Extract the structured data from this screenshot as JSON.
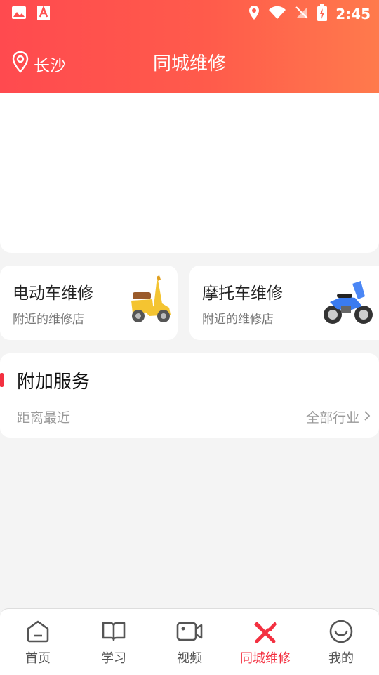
{
  "status_bar": {
    "time": "2:45"
  },
  "header": {
    "location": "长沙",
    "title": "同城维修"
  },
  "categories": [
    {
      "title": "电动车维修",
      "subtitle": "附近的维修店",
      "icon": "scooter-icon"
    },
    {
      "title": "摩托车维修",
      "subtitle": "附近的维修店",
      "icon": "motorcycle-icon"
    }
  ],
  "services": {
    "title": "附加服务",
    "sort_label": "距离最近",
    "industry_label": "全部行业"
  },
  "tabs": [
    {
      "label": "首页",
      "icon": "home-icon"
    },
    {
      "label": "学习",
      "icon": "book-icon"
    },
    {
      "label": "视频",
      "icon": "video-icon"
    },
    {
      "label": "同城维修",
      "icon": "tools-icon",
      "active": true
    },
    {
      "label": "我的",
      "icon": "smile-icon"
    }
  ],
  "colors": {
    "accent": "#f33040",
    "header_start": "#ff4a4f",
    "header_end": "#ff7a4c"
  }
}
